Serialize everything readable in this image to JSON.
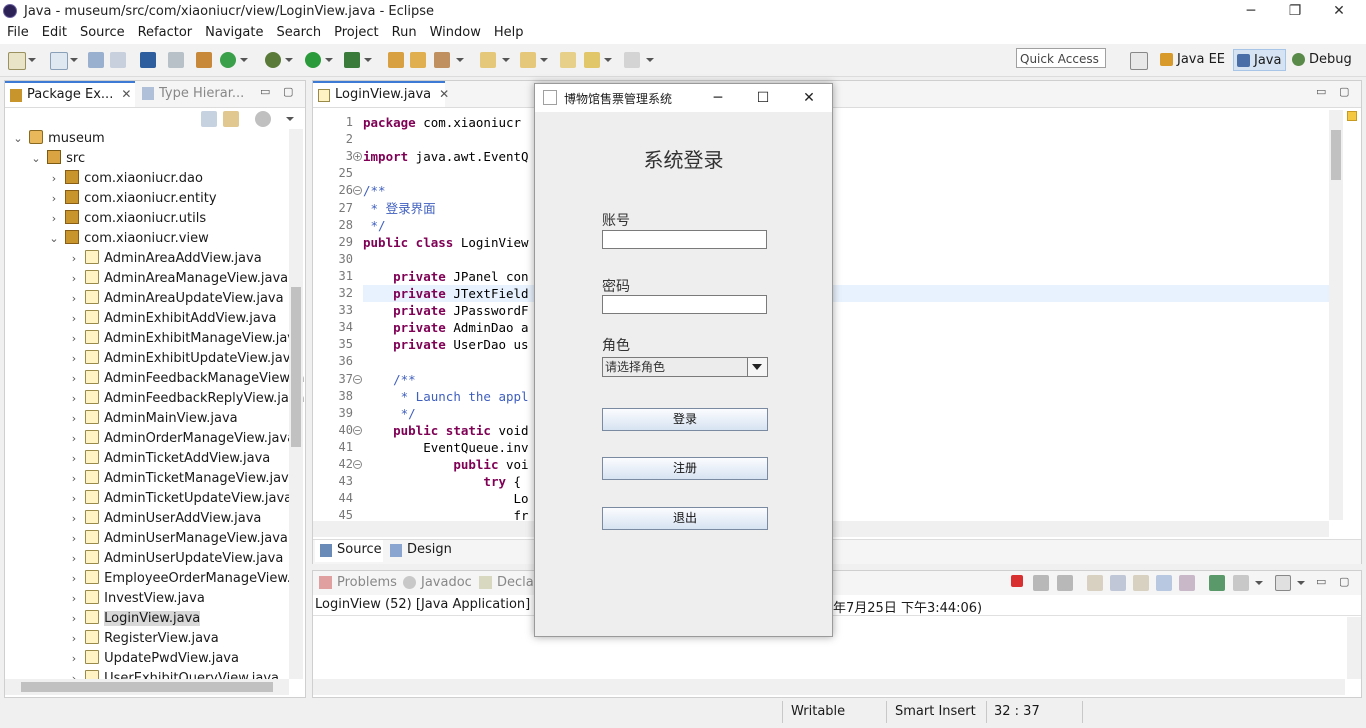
{
  "window": {
    "title": "Java - museum/src/com/xiaoniucr/view/LoginView.java - Eclipse",
    "minimize": "─",
    "restore": "❐",
    "close": "✕"
  },
  "menu": [
    "File",
    "Edit",
    "Source",
    "Refactor",
    "Navigate",
    "Search",
    "Project",
    "Run",
    "Window",
    "Help"
  ],
  "toolbar": {
    "quick_access": "Quick Access",
    "perspectives": [
      {
        "label": "Java EE",
        "active": false
      },
      {
        "label": "Java",
        "active": true
      },
      {
        "label": "Debug",
        "active": false
      }
    ]
  },
  "explorer": {
    "tab_active": "Package Ex...",
    "tab_inactive": "Type Hierar...",
    "tab_close": "✕",
    "project": "museum",
    "src": "src",
    "packages": [
      "com.xiaoniucr.dao",
      "com.xiaoniucr.entity",
      "com.xiaoniucr.utils",
      "com.xiaoniucr.view"
    ],
    "files": [
      "AdminAreaAddView.java",
      "AdminAreaManageView.java",
      "AdminAreaUpdateView.java",
      "AdminExhibitAddView.java",
      "AdminExhibitManageView.java",
      "AdminExhibitUpdateView.java",
      "AdminFeedbackManageView.ja",
      "AdminFeedbackReplyView.java",
      "AdminMainView.java",
      "AdminOrderManageView.java",
      "AdminTicketAddView.java",
      "AdminTicketManageView.java",
      "AdminTicketUpdateView.java",
      "AdminUserAddView.java",
      "AdminUserManageView.java",
      "AdminUserUpdateView.java",
      "EmployeeOrderManageView.ja",
      "InvestView.java",
      "LoginView.java",
      "RegisterView.java",
      "UpdatePwdView.java",
      "UserExhibitQueryView.java"
    ],
    "selected_file": "LoginView.java"
  },
  "editor": {
    "tab": "LoginView.java",
    "tab_close": "✕",
    "lines": [
      {
        "n": "1",
        "pre": "",
        "kw": "package",
        "rest": " com.xiaoniucr",
        "cls": ""
      },
      {
        "n": "2",
        "pre": "",
        "kw": "",
        "rest": "",
        "cls": ""
      },
      {
        "n": "3",
        "pre": "",
        "kw": "import",
        "rest": " java.awt.EventQ",
        "cls": ""
      },
      {
        "n": "25",
        "pre": "",
        "kw": "",
        "rest": "",
        "cls": ""
      },
      {
        "n": "26",
        "pre": "",
        "kw": "",
        "rest": "/**",
        "cls": "cm"
      },
      {
        "n": "27",
        "pre": "",
        "kw": "",
        "rest": " * 登录界面",
        "cls": "cm"
      },
      {
        "n": "28",
        "pre": "",
        "kw": "",
        "rest": " */",
        "cls": "cm"
      },
      {
        "n": "29",
        "pre": "",
        "kw": "public class",
        "rest": " LoginView",
        "cls": ""
      },
      {
        "n": "30",
        "pre": "",
        "kw": "",
        "rest": "",
        "cls": ""
      },
      {
        "n": "31",
        "pre": "    ",
        "kw": "private",
        "rest": " JPanel con",
        "cls": ""
      },
      {
        "n": "32",
        "pre": "    ",
        "kw": "private",
        "rest": " JTextField",
        "cls": ""
      },
      {
        "n": "33",
        "pre": "    ",
        "kw": "private",
        "rest": " JPasswordF",
        "cls": ""
      },
      {
        "n": "34",
        "pre": "    ",
        "kw": "private",
        "rest": " AdminDao a",
        "cls": ""
      },
      {
        "n": "35",
        "pre": "    ",
        "kw": "private",
        "rest": " UserDao us",
        "cls": ""
      },
      {
        "n": "36",
        "pre": "",
        "kw": "",
        "rest": "",
        "cls": ""
      },
      {
        "n": "37",
        "pre": "    ",
        "kw": "",
        "rest": "/**",
        "cls": "cm"
      },
      {
        "n": "38",
        "pre": "    ",
        "kw": "",
        "rest": " * Launch the appl",
        "cls": "cm"
      },
      {
        "n": "39",
        "pre": "    ",
        "kw": "",
        "rest": " */",
        "cls": "cm"
      },
      {
        "n": "40",
        "pre": "    ",
        "kw": "public static",
        "rest": " void",
        "cls": ""
      },
      {
        "n": "41",
        "pre": "        ",
        "kw": "",
        "rest": "EventQueue.inv",
        "cls": ""
      },
      {
        "n": "42",
        "pre": "            ",
        "kw": "public",
        "rest": " voi",
        "cls": ""
      },
      {
        "n": "43",
        "pre": "                ",
        "kw": "try",
        "rest": " {",
        "cls": ""
      },
      {
        "n": "44",
        "pre": "                    ",
        "kw": "",
        "rest": "Lo",
        "cls": ""
      },
      {
        "n": "45",
        "pre": "                    ",
        "kw": "",
        "rest": "fr",
        "cls": ""
      }
    ],
    "bottom_tabs": [
      "Source",
      "Design"
    ]
  },
  "console": {
    "tabs": [
      "Problems",
      "Javadoc",
      "Declar"
    ],
    "line": "LoginView (52) [Java Application] C:\\Pr",
    "line_tail": "年7月25日 下午3:44:06)"
  },
  "dialog": {
    "title": "博物馆售票管理系统",
    "heading": "系统登录",
    "account_label": "账号",
    "password_label": "密码",
    "role_label": "角色",
    "role_placeholder": "请选择角色",
    "login_button": "登录",
    "register_button": "注册",
    "exit_button": "退出",
    "minimize": "─",
    "maximize": "☐",
    "close": "✕"
  },
  "status": {
    "writable": "Writable",
    "insert_mode": "Smart Insert",
    "position": "32 : 37"
  }
}
